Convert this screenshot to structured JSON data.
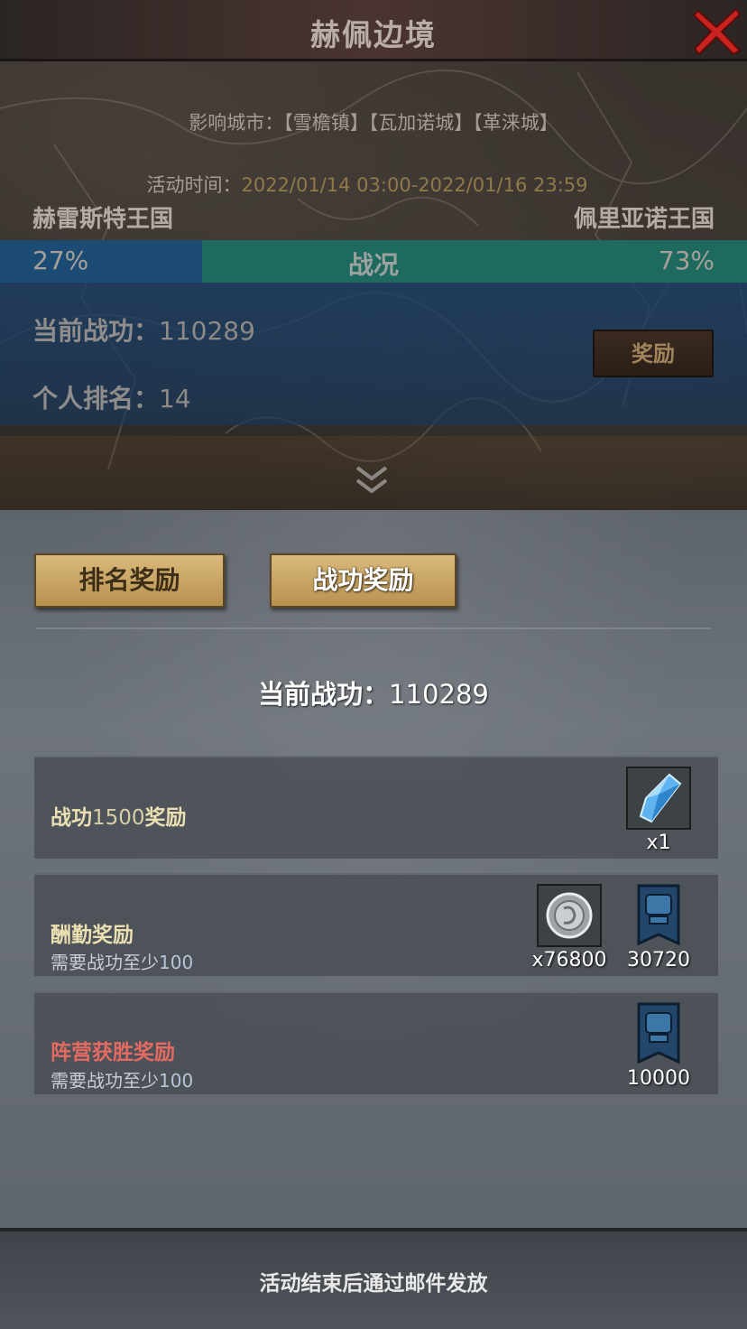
{
  "header": {
    "title": "赫佩边境"
  },
  "info": {
    "cities_label": "影响城市：",
    "cities": "【雪檐镇】【瓦加诺城】【革涞城】",
    "time_label": "活动时间：",
    "time_value": "2022/01/14 03:00-2022/01/16 23:59"
  },
  "war": {
    "left_kingdom": "赫雷斯特王国",
    "right_kingdom": "佩里亚诺王国",
    "left_pct_text": "27%",
    "right_pct_text": "73%",
    "left_pct": 0.27,
    "status_label": "战况"
  },
  "stats": {
    "merit_label": "当前战功：",
    "merit_value": "110289",
    "rank_label": "个人排名：",
    "rank_value": "14",
    "reward_button": "奖励"
  },
  "tabs": {
    "rank": "排名奖励",
    "merit": "战功奖励"
  },
  "panel": {
    "current_merit_label": "当前战功：",
    "current_merit_value": "110289",
    "rows": [
      {
        "title_prefix": "战功",
        "title_num": "1500",
        "title_suffix": "奖励",
        "items": [
          {
            "icon": "crystal-icon",
            "count": "x1"
          }
        ]
      },
      {
        "title": "酬勤奖励",
        "sub_prefix": "需要战功至少",
        "sub_num": "100",
        "items": [
          {
            "icon": "silver-coin-icon",
            "count": "x76800"
          },
          {
            "icon": "banner-icon",
            "count": "30720"
          }
        ]
      },
      {
        "title": "阵营获胜奖励",
        "sub_prefix": "需要战功至少",
        "sub_num": "100",
        "items": [
          {
            "icon": "banner-icon",
            "count": "10000"
          }
        ]
      }
    ]
  },
  "footer": {
    "text": "活动结束后通过邮件发放"
  },
  "colors": {
    "left_bar": "#1c4c73",
    "right_bar": "#1f6a5e",
    "tab_gold": "#c9a563",
    "red_title": "#e56a62"
  }
}
